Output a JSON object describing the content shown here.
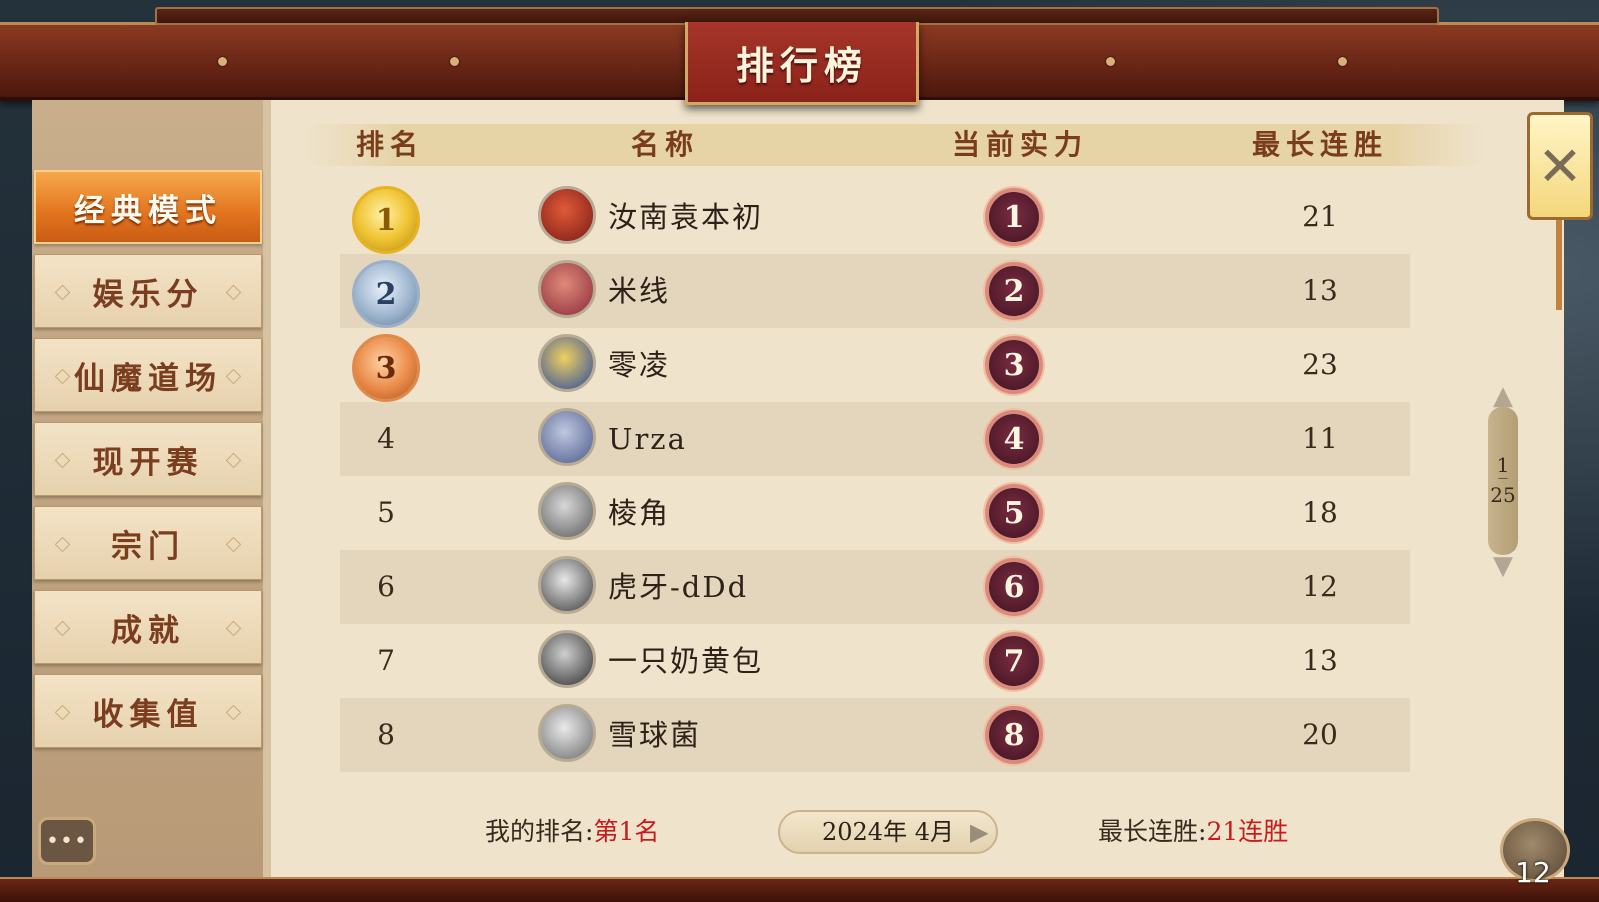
{
  "title": "排行榜",
  "sidebar": {
    "items": [
      {
        "label": "经典模式",
        "active": true
      },
      {
        "label": "娱乐分",
        "active": false
      },
      {
        "label": "仙魔道场",
        "active": false
      },
      {
        "label": "现开赛",
        "active": false
      },
      {
        "label": "宗门",
        "active": false
      },
      {
        "label": "成就",
        "active": false
      },
      {
        "label": "收集值",
        "active": false
      }
    ]
  },
  "table": {
    "headers": {
      "rank": "排名",
      "name": "名称",
      "power": "当前实力",
      "streak": "最长连胜"
    },
    "rows": [
      {
        "rank": "1",
        "name": "汝南袁本初",
        "power": "1",
        "streak": "21"
      },
      {
        "rank": "2",
        "name": "米线",
        "power": "2",
        "streak": "13"
      },
      {
        "rank": "3",
        "name": "零凌",
        "power": "3",
        "streak": "23"
      },
      {
        "rank": "4",
        "name": "Urza",
        "power": "4",
        "streak": "11"
      },
      {
        "rank": "5",
        "name": "棱角",
        "power": "5",
        "streak": "18"
      },
      {
        "rank": "6",
        "name": "虎牙-dDd",
        "power": "6",
        "streak": "12"
      },
      {
        "rank": "7",
        "name": "一只奶黄包",
        "power": "7",
        "streak": "13"
      },
      {
        "rank": "8",
        "name": "雪球菌",
        "power": "8",
        "streak": "20"
      }
    ]
  },
  "pager": {
    "current": "1",
    "total": "25"
  },
  "footer": {
    "my_rank_label": "我的排名:",
    "my_rank_value": "第1名",
    "date": "2024年 4月",
    "streak_label": "最长连胜:",
    "streak_value": "21连胜"
  },
  "badge_count": "12",
  "icons": {
    "close": "close-icon",
    "chat": "chat-icon",
    "scroll_up": "scroll-up-icon",
    "scroll_down": "scroll-down-icon",
    "date_prev": "chevron-left-icon",
    "date_next": "chevron-right-icon"
  },
  "colors": {
    "accent_orange": "#e2731e",
    "title_red": "#a6352a",
    "highlight_red": "#c51d1d",
    "parchment": "#efe3cc"
  }
}
